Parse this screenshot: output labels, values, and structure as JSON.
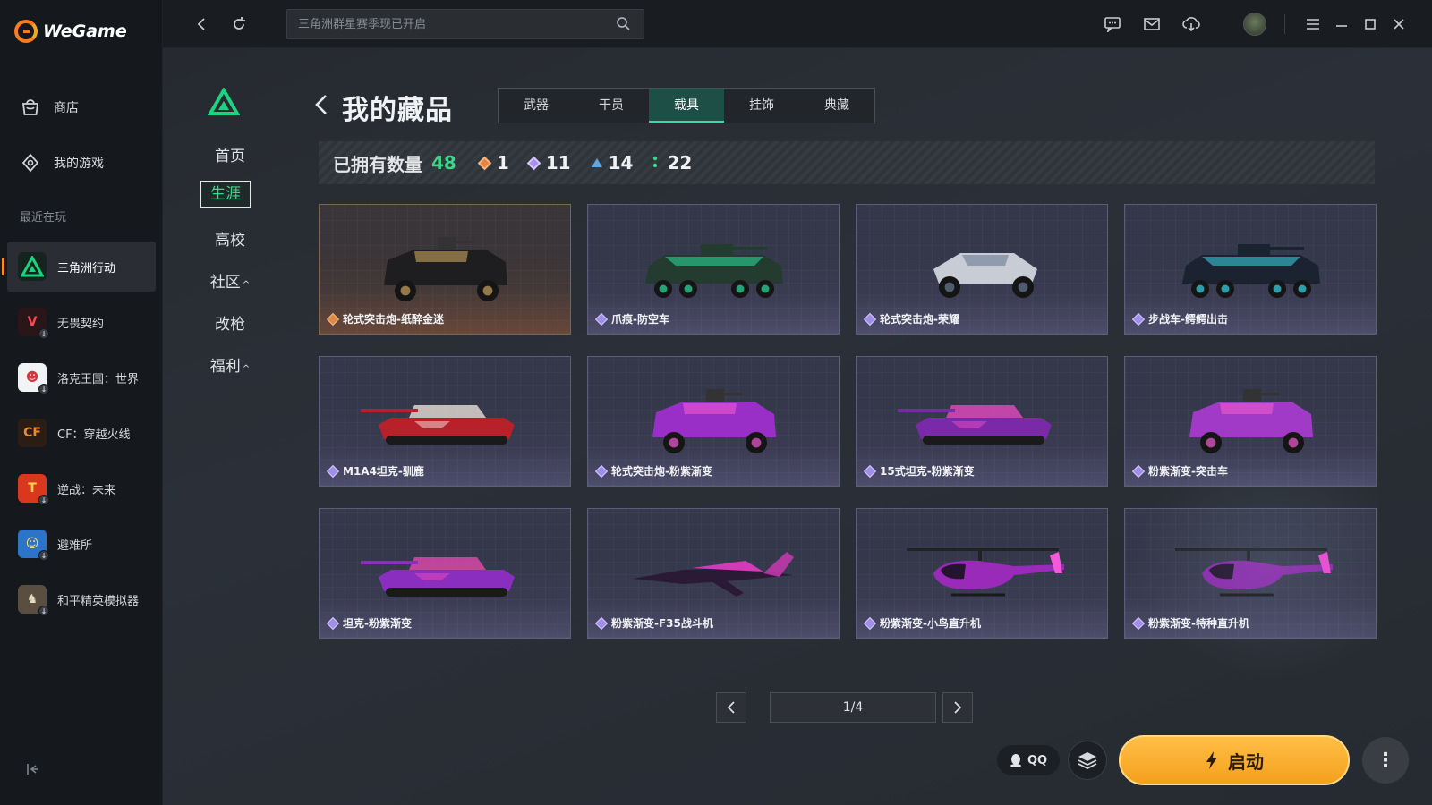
{
  "app": {
    "name": "WeGame"
  },
  "sidebar": {
    "nav": [
      {
        "label": "商店",
        "icon": "store-bag-icon"
      },
      {
        "label": "我的游戏",
        "icon": "gamepad-icon"
      }
    ],
    "recent_label": "最近在玩",
    "games": [
      {
        "label": "三角洲行动",
        "active": true,
        "color": "#1bd47f"
      },
      {
        "label": "无畏契约",
        "color": "#ff4655"
      },
      {
        "label": "洛克王国：世界",
        "color": "#f7d66e"
      },
      {
        "label": "CF：穿越火线",
        "color": "#f08a24"
      },
      {
        "label": "逆战：未来",
        "color": "#ff5a2a"
      },
      {
        "label": "避难所",
        "color": "#3fa0e8"
      },
      {
        "label": "和平精英模拟器",
        "color": "#b09a7c"
      }
    ]
  },
  "topbar": {
    "search_placeholder": "三角洲群星赛季现已开启"
  },
  "game_nav": {
    "items": [
      {
        "label": "首页"
      },
      {
        "label": "生涯",
        "active": true
      },
      {
        "label": "高校"
      },
      {
        "label": "社区",
        "caret": "^"
      },
      {
        "label": "改枪"
      },
      {
        "label": "福利",
        "caret": "^"
      }
    ]
  },
  "page": {
    "title": "我的藏品",
    "tabs": [
      {
        "label": "武器"
      },
      {
        "label": "干员"
      },
      {
        "label": "载具",
        "active": true
      },
      {
        "label": "挂饰"
      },
      {
        "label": "典藏"
      }
    ],
    "stats": {
      "label": "已拥有数量",
      "total": "48",
      "tiers": [
        {
          "value": "1",
          "color": "#e8843c"
        },
        {
          "value": "11",
          "color": "#a98ef0"
        },
        {
          "value": "14",
          "color": "#5aa8e8"
        },
        {
          "value": "22",
          "color": "#3bd88a"
        }
      ]
    },
    "items": [
      {
        "name": "轮式突击炮-纸醉金迷",
        "rarity": "gold",
        "body": "#1e1e20",
        "accent": "#c9a360",
        "kind": "apc4"
      },
      {
        "name": "爪痕-防空车",
        "rarity": "purple",
        "body": "#243b30",
        "accent": "#2ee0a0",
        "kind": "apc8"
      },
      {
        "name": "轮式突击炮-荣耀",
        "rarity": "purple",
        "body": "#c8ccd4",
        "accent": "#6b7a96",
        "kind": "buggy"
      },
      {
        "name": "步战车-鳄鳄出击",
        "rarity": "purple",
        "body": "#1b2230",
        "accent": "#3ad6e8",
        "kind": "apc8"
      },
      {
        "name": "M1A4坦克-驯鹿",
        "rarity": "purple",
        "body": "#b8202a",
        "accent": "#f2e9e0",
        "kind": "tank"
      },
      {
        "name": "轮式突击炮-粉紫渐变",
        "rarity": "purple",
        "body": "#9a2fc8",
        "accent": "#f05ad0",
        "kind": "apc4"
      },
      {
        "name": "15式坦克-粉紫渐变",
        "rarity": "purple",
        "body": "#7a2aa8",
        "accent": "#f24ac8",
        "kind": "tank"
      },
      {
        "name": "粉紫渐变-突击车",
        "rarity": "purple",
        "body": "#a23ac8",
        "accent": "#ef5ccd",
        "kind": "apc4"
      },
      {
        "name": "坦克-粉紫渐变",
        "rarity": "purple",
        "body": "#8a2ec0",
        "accent": "#ee4ab8",
        "kind": "tank"
      },
      {
        "name": "粉紫渐变-F35战斗机",
        "rarity": "purple",
        "body": "#2a1a38",
        "accent": "#d23ab8",
        "kind": "jet"
      },
      {
        "name": "粉紫渐变-小鸟直升机",
        "rarity": "purple",
        "body": "#9a2ab8",
        "accent": "#f25ad8",
        "kind": "heli"
      },
      {
        "name": "粉紫渐变-特种直升机",
        "rarity": "purple",
        "body": "#8a2aa8",
        "accent": "#e84ad0",
        "kind": "heli"
      }
    ],
    "pagination": {
      "label": "1/4",
      "current": 1,
      "total": 4
    }
  },
  "launcher": {
    "qq_label": "QQ",
    "launch_label": "启动",
    "more_label": "⋮"
  }
}
